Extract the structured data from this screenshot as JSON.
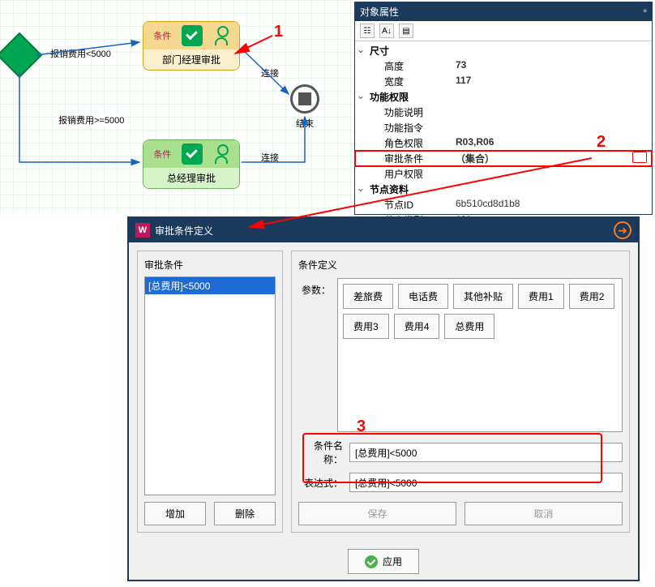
{
  "flow": {
    "edge1_label": "报销费用<5000",
    "edge2_label": "报销费用>=5000",
    "conn_label1": "连接",
    "conn_label2": "连接",
    "end_label": "结束",
    "node1": {
      "cond": "条件",
      "title": "部门经理审批"
    },
    "node2": {
      "cond": "条件",
      "title": "总经理审批"
    }
  },
  "prop": {
    "panel_title": "对象属性",
    "cat_size": "尺寸",
    "height_k": "高度",
    "height_v": "73",
    "width_k": "宽度",
    "width_v": "117",
    "cat_func": "功能权限",
    "func_desc_k": "功能说明",
    "func_cmd_k": "功能指令",
    "role_k": "角色权限",
    "role_v": "R03,R06",
    "approve_k": "审批条件",
    "approve_v": "（集合）",
    "user_k": "用户权限",
    "cat_node": "节点资料",
    "nodeid_k": "节点ID",
    "nodeid_v": "6b510cd8d1b8",
    "nodetype_k": "节点类型",
    "nodetype_v": "任务"
  },
  "dialog": {
    "title": "审批条件定义",
    "left_title": "审批条件",
    "list_item": "[总费用]<5000",
    "add_btn": "增加",
    "del_btn": "删除",
    "right_title": "条件定义",
    "param_label": "参数：",
    "params": [
      "差旅费",
      "电话费",
      "其他补贴",
      "费用1",
      "费用2",
      "费用3",
      "费用4",
      "总费用"
    ],
    "name_label": "条件名称：",
    "name_value": "[总费用]<5000",
    "expr_label": "表达式：",
    "expr_value": "[总费用]<5000",
    "save_btn": "保存",
    "cancel_btn": "取消",
    "apply_btn": "应用"
  },
  "anno": {
    "n1": "1",
    "n2": "2",
    "n3": "3"
  }
}
